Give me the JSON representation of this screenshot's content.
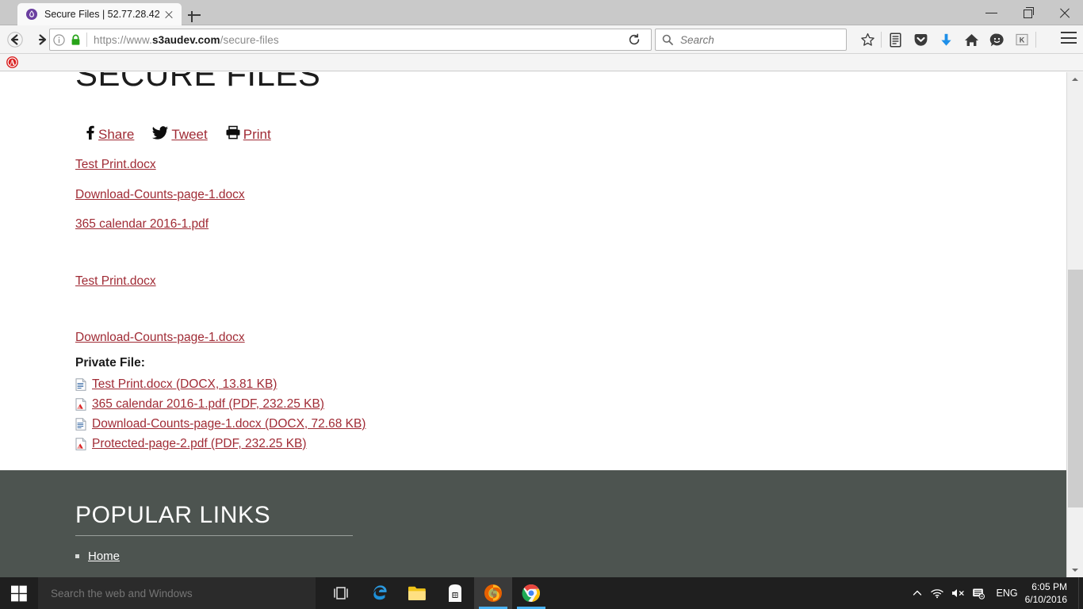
{
  "browser": {
    "tab": {
      "title": "Secure Files | 52.77.28.42",
      "favicon": "droplet-icon"
    },
    "newtab_label": "+",
    "window_controls": {
      "minimize": "minimize-icon",
      "maximize": "restore-icon",
      "close": "close-icon"
    },
    "nav": {
      "back": "back-arrow-icon",
      "forward": "forward-arrow-icon",
      "identity": "page-info-icon",
      "lock": "lock-icon",
      "url_scheme": "https://www.",
      "url_domain": "s3audev.com",
      "url_path": "/secure-files",
      "url_full": "https://www.s3audev.com/secure-files",
      "reload": "reload-icon"
    },
    "search": {
      "placeholder": "Search",
      "value": "",
      "icon": "search-icon"
    },
    "toolbar_icons": [
      "star-icon",
      "reader-list-icon",
      "pocket-icon",
      "download-arrow-icon",
      "home-icon",
      "smiley-icon",
      "k-extension-icon",
      "hamburger-menu-icon"
    ],
    "bookmarks": [
      {
        "name": "alert-bookmark-icon",
        "label": ""
      }
    ]
  },
  "page": {
    "title": "SECURE FILES",
    "share": [
      {
        "label": "Share",
        "icon": "facebook-icon"
      },
      {
        "label": "Tweet",
        "icon": "twitter-icon"
      },
      {
        "label": "Print",
        "icon": "printer-icon"
      }
    ],
    "public_files_top": [
      "Test Print.docx",
      "Download-Counts-page-1.docx",
      "365 calendar 2016-1.pdf"
    ],
    "public_files_mid": [
      "Test Print.docx",
      "Download-Counts-page-1.docx"
    ],
    "private_heading": "Private File:",
    "private_files": [
      {
        "label": "Test Print.docx (DOCX, 13.81 KB)",
        "icon": "docx-file-icon"
      },
      {
        "label": "365 calendar 2016-1.pdf (PDF, 232.25 KB)",
        "icon": "pdf-file-icon"
      },
      {
        "label": "Download-Counts-page-1.docx (DOCX, 72.68 KB)",
        "icon": "docx-file-icon"
      },
      {
        "label": "Protected-page-2.pdf (PDF, 232.25 KB)",
        "icon": "pdf-file-icon"
      }
    ],
    "footer": {
      "heading": "POPULAR LINKS",
      "links": [
        "Home"
      ],
      "bg_color": "#4d5450"
    },
    "link_color": "#a02b35"
  },
  "scrollbar": {
    "up": "scroll-up-arrow",
    "down": "scroll-down-arrow"
  },
  "taskbar": {
    "start": "windows-start-icon",
    "search_placeholder": "Search the web and Windows",
    "search_value": "",
    "task_view": "task-view-icon",
    "apps": [
      {
        "name": "edge-icon"
      },
      {
        "name": "file-explorer-icon"
      },
      {
        "name": "store-icon"
      },
      {
        "name": "firefox-icon"
      },
      {
        "name": "chrome-icon"
      }
    ],
    "tray": {
      "chevron": "show-hidden-icons",
      "network": "wifi-icon",
      "volume": "volume-muted-icon",
      "action_center": "action-center-icon",
      "language": "ENG",
      "time": "6:05 PM",
      "date": "6/10/2016"
    }
  }
}
